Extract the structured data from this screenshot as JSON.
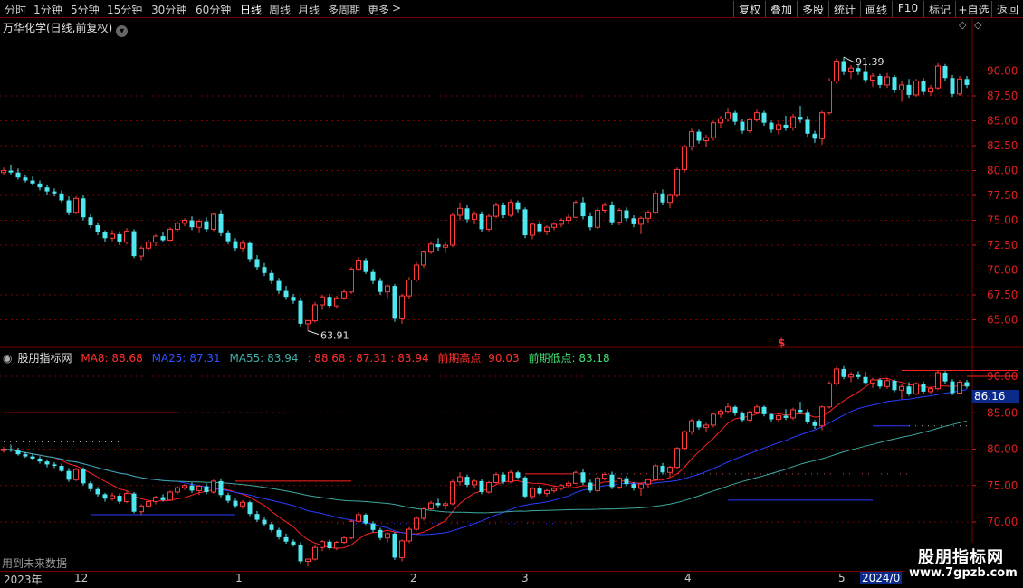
{
  "toolbar": {
    "periods": [
      "分时",
      "1分钟",
      "5分钟",
      "15分钟",
      "30分钟",
      "60分钟",
      "日线",
      "周线",
      "月线",
      "多周期",
      "更多"
    ],
    "more_arrow": ">",
    "right_buttons": [
      "复权",
      "叠加",
      "多股",
      "统计",
      "画线",
      "F10",
      "标记",
      "+自选",
      "返回"
    ]
  },
  "main_chart": {
    "title": "万华化学(日线,前复权)",
    "dropdown_glyph": "▾",
    "high_label": "91.39",
    "low_label": "63.91",
    "axis_ticks": [
      "90.00",
      "87.50",
      "85.00",
      "82.50",
      "80.00",
      "77.50",
      "75.00",
      "72.50",
      "70.00",
      "67.50",
      "65.00"
    ],
    "corner_icons": [
      "◇",
      "◇"
    ],
    "dollar_mark": "$"
  },
  "indicator": {
    "name": "股朋指标网",
    "ma8_label": "MA8: 88.68",
    "ma25_label": "MA25: 87.31",
    "ma55_label": "MA55: 83.94",
    "vals_label": ": 88.68 : 87.31 : 83.94",
    "prev_high_label": "前期高点: 90.03",
    "prev_low_label": "前期低点: 83.18",
    "axis_ticks": [
      "90.00",
      "85.00",
      "80.00",
      "75.00",
      "70.00"
    ],
    "price_box": "86.16",
    "note": "用到未来数据"
  },
  "date_axis": {
    "labels": [
      "2023年",
      "12",
      "1",
      "2",
      "3",
      "4",
      "5",
      "2024/0"
    ]
  },
  "watermark": {
    "title": "股朋指标网",
    "url": "www.7gpzb.com"
  },
  "colors": {
    "up": "#ff3b3b",
    "down": "#4fe8f0",
    "ma8": "#ff2020",
    "ma25": "#2b3cff",
    "ma55": "#3ea8a0",
    "border": "#7a0000",
    "prev_high": "#ff2020",
    "prev_low": "#2b3cff"
  },
  "chart_data": {
    "type": "candlestick",
    "symbol": "万华化学",
    "period": "日线",
    "ylim": [
      63.5,
      93.5
    ],
    "candles": [
      [
        79.8,
        80.3,
        79.5,
        80.0
      ],
      [
        80.0,
        80.6,
        79.6,
        79.8
      ],
      [
        79.8,
        80.2,
        79.1,
        79.3
      ],
      [
        79.3,
        79.6,
        78.8,
        79.0
      ],
      [
        79.0,
        79.4,
        78.5,
        78.7
      ],
      [
        78.7,
        79.0,
        78.0,
        78.3
      ],
      [
        78.3,
        78.6,
        77.5,
        77.9
      ],
      [
        77.9,
        78.2,
        77.4,
        77.7
      ],
      [
        77.7,
        78.0,
        76.8,
        77.0
      ],
      [
        77.0,
        77.4,
        75.5,
        75.8
      ],
      [
        75.8,
        77.4,
        75.6,
        77.2
      ],
      [
        77.2,
        77.5,
        75.0,
        75.3
      ],
      [
        75.3,
        75.6,
        74.2,
        74.5
      ],
      [
        74.5,
        74.8,
        73.5,
        73.8
      ],
      [
        73.8,
        74.0,
        72.8,
        73.2
      ],
      [
        73.2,
        74.0,
        72.9,
        73.6
      ],
      [
        73.6,
        73.9,
        72.5,
        72.8
      ],
      [
        72.8,
        74.2,
        72.6,
        73.9
      ],
      [
        73.9,
        74.1,
        71.2,
        71.4
      ],
      [
        71.4,
        72.4,
        71.0,
        72.2
      ],
      [
        72.2,
        73.0,
        72.0,
        72.8
      ],
      [
        72.8,
        73.6,
        72.4,
        73.4
      ],
      [
        73.4,
        73.8,
        72.8,
        73.0
      ],
      [
        73.0,
        74.3,
        72.9,
        74.1
      ],
      [
        74.1,
        74.9,
        73.8,
        74.7
      ],
      [
        74.7,
        75.2,
        74.4,
        75.0
      ],
      [
        75.0,
        75.4,
        74.0,
        74.3
      ],
      [
        74.3,
        75.1,
        73.7,
        74.9
      ],
      [
        74.9,
        75.3,
        73.8,
        74.1
      ],
      [
        74.1,
        75.8,
        73.9,
        75.6
      ],
      [
        75.6,
        76.0,
        73.4,
        73.7
      ],
      [
        73.7,
        74.0,
        72.6,
        72.9
      ],
      [
        72.9,
        73.2,
        71.9,
        72.2
      ],
      [
        72.2,
        73.0,
        71.8,
        72.7
      ],
      [
        72.7,
        72.9,
        70.8,
        71.1
      ],
      [
        71.1,
        71.5,
        70.0,
        70.3
      ],
      [
        70.3,
        70.7,
        69.4,
        69.7
      ],
      [
        69.7,
        70.0,
        68.6,
        68.9
      ],
      [
        68.9,
        69.2,
        67.6,
        67.9
      ],
      [
        67.9,
        68.4,
        67.0,
        67.3
      ],
      [
        67.3,
        67.6,
        66.6,
        66.9
      ],
      [
        66.9,
        67.2,
        64.3,
        64.6
      ],
      [
        64.6,
        65.0,
        63.9,
        64.9
      ],
      [
        64.9,
        66.8,
        64.7,
        66.5
      ],
      [
        66.5,
        67.5,
        66.0,
        67.3
      ],
      [
        67.3,
        67.6,
        66.2,
        66.4
      ],
      [
        66.4,
        67.4,
        66.1,
        67.2
      ],
      [
        67.2,
        68.0,
        67.0,
        67.8
      ],
      [
        67.8,
        70.3,
        67.6,
        70.1
      ],
      [
        70.1,
        71.3,
        69.9,
        71.0
      ],
      [
        71.0,
        71.2,
        69.6,
        69.8
      ],
      [
        69.8,
        70.1,
        68.6,
        68.9
      ],
      [
        68.9,
        69.2,
        67.5,
        67.8
      ],
      [
        67.8,
        68.6,
        67.2,
        68.4
      ],
      [
        68.4,
        68.6,
        64.8,
        65.1
      ],
      [
        65.1,
        67.6,
        64.6,
        67.4
      ],
      [
        67.4,
        69.3,
        67.1,
        69.0
      ],
      [
        69.0,
        70.8,
        68.8,
        70.5
      ],
      [
        70.5,
        72.0,
        70.2,
        71.8
      ],
      [
        71.8,
        72.9,
        71.6,
        72.6
      ],
      [
        72.6,
        73.2,
        71.9,
        72.3
      ],
      [
        72.3,
        72.8,
        71.7,
        72.5
      ],
      [
        72.5,
        75.8,
        72.3,
        75.5
      ],
      [
        75.5,
        76.8,
        75.0,
        76.2
      ],
      [
        76.2,
        76.5,
        74.8,
        75.1
      ],
      [
        75.1,
        75.9,
        74.6,
        75.6
      ],
      [
        75.6,
        75.9,
        73.8,
        74.1
      ],
      [
        74.1,
        75.6,
        73.9,
        75.4
      ],
      [
        75.4,
        76.8,
        75.2,
        76.5
      ],
      [
        76.5,
        76.8,
        75.2,
        75.5
      ],
      [
        75.5,
        77.1,
        75.3,
        76.8
      ],
      [
        76.8,
        77.0,
        75.8,
        76.1
      ],
      [
        76.1,
        76.3,
        73.2,
        73.5
      ],
      [
        73.5,
        74.8,
        73.1,
        74.6
      ],
      [
        74.6,
        74.9,
        73.7,
        73.9
      ],
      [
        73.9,
        74.5,
        73.5,
        74.3
      ],
      [
        74.3,
        74.8,
        74.0,
        74.6
      ],
      [
        74.6,
        75.2,
        74.3,
        75.0
      ],
      [
        75.0,
        75.6,
        74.6,
        75.3
      ],
      [
        75.3,
        77.0,
        75.2,
        76.8
      ],
      [
        76.8,
        77.3,
        75.1,
        75.4
      ],
      [
        75.4,
        75.8,
        74.0,
        74.3
      ],
      [
        74.3,
        76.3,
        74.1,
        76.0
      ],
      [
        76.0,
        76.8,
        75.7,
        76.5
      ],
      [
        76.5,
        76.9,
        74.5,
        74.8
      ],
      [
        74.8,
        76.2,
        74.5,
        76.0
      ],
      [
        76.0,
        76.3,
        74.9,
        75.2
      ],
      [
        75.2,
        75.5,
        74.3,
        74.6
      ],
      [
        74.6,
        75.4,
        73.6,
        75.2
      ],
      [
        75.2,
        76.0,
        74.7,
        75.8
      ],
      [
        75.8,
        78.0,
        75.6,
        77.7
      ],
      [
        77.7,
        78.1,
        76.5,
        76.8
      ],
      [
        76.8,
        77.7,
        76.2,
        77.5
      ],
      [
        77.5,
        80.3,
        77.3,
        80.1
      ],
      [
        80.1,
        82.6,
        79.8,
        82.4
      ],
      [
        82.4,
        84.2,
        82.0,
        83.9
      ],
      [
        83.9,
        84.1,
        82.7,
        83.0
      ],
      [
        83.0,
        83.6,
        82.4,
        83.3
      ],
      [
        83.3,
        85.0,
        83.0,
        84.8
      ],
      [
        84.8,
        85.5,
        84.3,
        85.2
      ],
      [
        85.2,
        86.3,
        84.9,
        85.8
      ],
      [
        85.8,
        86.0,
        84.6,
        84.9
      ],
      [
        84.9,
        85.2,
        83.7,
        84.0
      ],
      [
        84.0,
        85.3,
        83.8,
        85.1
      ],
      [
        85.1,
        86.1,
        84.9,
        85.8
      ],
      [
        85.8,
        86.0,
        84.5,
        84.8
      ],
      [
        84.8,
        85.0,
        83.8,
        84.1
      ],
      [
        84.1,
        85.0,
        83.6,
        84.6
      ],
      [
        84.6,
        85.5,
        84.0,
        84.3
      ],
      [
        84.3,
        85.7,
        84.0,
        85.4
      ],
      [
        85.4,
        86.5,
        84.8,
        85.1
      ],
      [
        85.1,
        85.5,
        83.4,
        83.7
      ],
      [
        83.7,
        84.0,
        82.8,
        83.2
      ],
      [
        83.2,
        86.0,
        82.6,
        85.8
      ],
      [
        85.8,
        89.3,
        85.6,
        89.0
      ],
      [
        89.0,
        91.3,
        88.7,
        91.0
      ],
      [
        91.0,
        91.4,
        89.6,
        89.9
      ],
      [
        89.9,
        90.6,
        89.2,
        90.3
      ],
      [
        90.3,
        90.7,
        89.6,
        89.9
      ],
      [
        89.9,
        90.6,
        88.8,
        89.1
      ],
      [
        89.1,
        89.8,
        88.4,
        89.5
      ],
      [
        89.5,
        89.7,
        88.3,
        88.6
      ],
      [
        88.6,
        89.8,
        88.3,
        89.4
      ],
      [
        89.4,
        89.6,
        87.8,
        88.1
      ],
      [
        88.1,
        89.0,
        86.9,
        88.6
      ],
      [
        88.6,
        89.2,
        87.3,
        87.6
      ],
      [
        87.6,
        89.2,
        87.4,
        89.0
      ],
      [
        89.0,
        89.3,
        87.6,
        87.9
      ],
      [
        87.9,
        88.6,
        87.5,
        88.3
      ],
      [
        88.3,
        90.8,
        88.1,
        90.5
      ],
      [
        90.5,
        90.7,
        89.0,
        89.3
      ],
      [
        89.3,
        89.6,
        87.4,
        87.7
      ],
      [
        87.7,
        89.5,
        87.5,
        89.2
      ],
      [
        89.2,
        89.5,
        88.3,
        88.6
      ]
    ],
    "ma_lines": [
      {
        "name": "MA8",
        "last": 88.68
      },
      {
        "name": "MA25",
        "last": 87.31
      },
      {
        "name": "MA55",
        "last": 83.94
      }
    ],
    "prev_high": 90.03,
    "prev_low": 83.18,
    "high_mark": 91.39,
    "low_mark": 63.91,
    "grid": true
  }
}
